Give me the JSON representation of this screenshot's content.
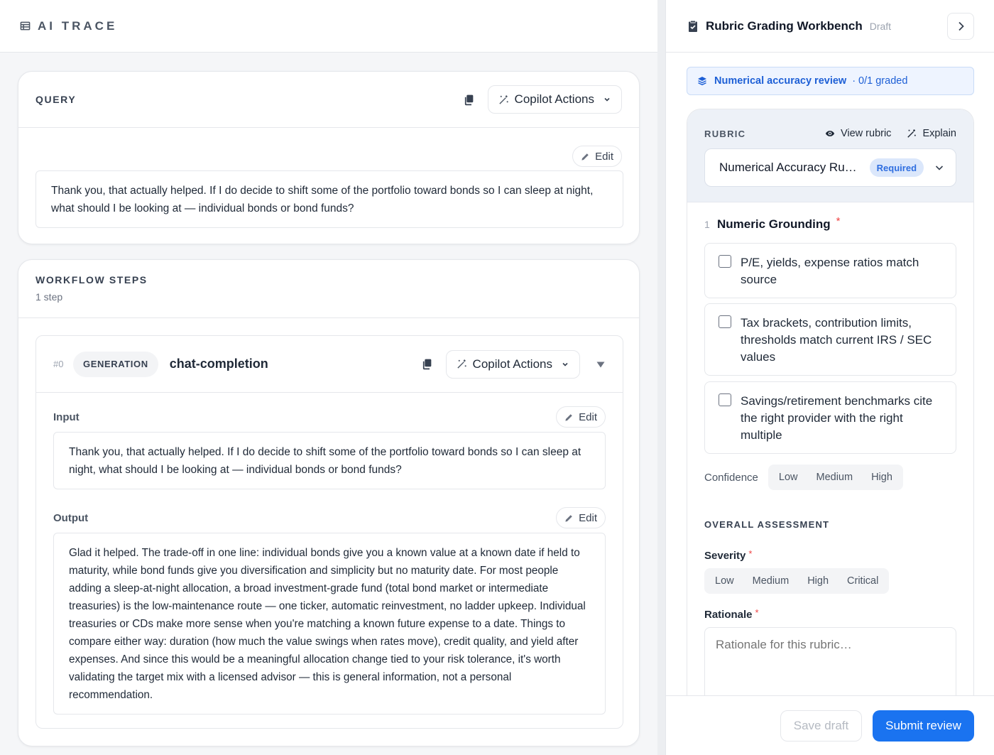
{
  "app": {
    "brand": "AI TRACE"
  },
  "query": {
    "label": "QUERY",
    "copilot_label": "Copilot Actions",
    "edit_label": "Edit",
    "text": "Thank you, that actually helped. If I do decide to shift some of the portfolio toward bonds so I can sleep at night, what should I be looking at — individual bonds or bond funds?"
  },
  "workflow": {
    "label": "WORKFLOW STEPS",
    "count": "1 step",
    "steps": [
      {
        "index": "#0",
        "type": "GENERATION",
        "name": "chat-completion",
        "copilot_label": "Copilot Actions",
        "input_label": "Input",
        "output_label": "Output",
        "edit_label": "Edit",
        "input": "Thank you, that actually helped. If I do decide to shift some of the portfolio toward bonds so I can sleep at night, what should I be looking at — individual bonds or bond funds?",
        "output": "Glad it helped. The trade-off in one line: individual bonds give you a known value at a known date if held to maturity, while bond funds give you diversification and simplicity but no maturity date. For most people adding a sleep-at-night allocation, a broad investment-grade fund (total bond market or intermediate treasuries) is the low-maintenance route — one ticker, automatic reinvestment, no ladder upkeep. Individual treasuries or CDs make more sense when you're matching a known future expense to a date. Things to compare either way: duration (how much the value swings when rates move), credit quality, and yield after expenses. And since this would be a meaningful allocation change tied to your risk tolerance, it's worth validating the target mix with a licensed advisor — this is general information, not a personal recommendation."
      }
    ]
  },
  "workbench": {
    "title": "Rubric Grading Workbench",
    "status": "Draft",
    "banner": {
      "title": "Numerical accuracy review",
      "progress": "· 0/1 graded"
    },
    "rubric": {
      "label": "RUBRIC",
      "view_label": "View rubric",
      "explain_label": "Explain",
      "selected": "Numerical Accuracy Ru…",
      "required_badge": "Required"
    },
    "criterion": {
      "number": "1",
      "title": "Numeric Grounding",
      "required_mark": "*",
      "checks": [
        {
          "text": "P/E, yields, expense ratios match source",
          "checked": false
        },
        {
          "text": "Tax brackets, contribution limits, thresholds match current IRS / SEC values",
          "checked": false
        },
        {
          "text": "Savings/retirement benchmarks cite the right provider with the right multiple",
          "checked": false
        }
      ],
      "confidence_label": "Confidence",
      "confidence_options": [
        "Low",
        "Medium",
        "High"
      ]
    },
    "overall": {
      "label": "OVERALL ASSESSMENT",
      "severity_label": "Severity",
      "severity_options": [
        "Low",
        "Medium",
        "High",
        "Critical"
      ],
      "rationale_label": "Rationale",
      "rationale_placeholder": "Rationale for this rubric…",
      "required_mark": "*"
    },
    "footer": {
      "save_label": "Save draft",
      "submit_label": "Submit review"
    }
  },
  "colors": {
    "accent": "#1a73f0",
    "required": "#ef4444",
    "banner_bg": "#eef4ff"
  }
}
